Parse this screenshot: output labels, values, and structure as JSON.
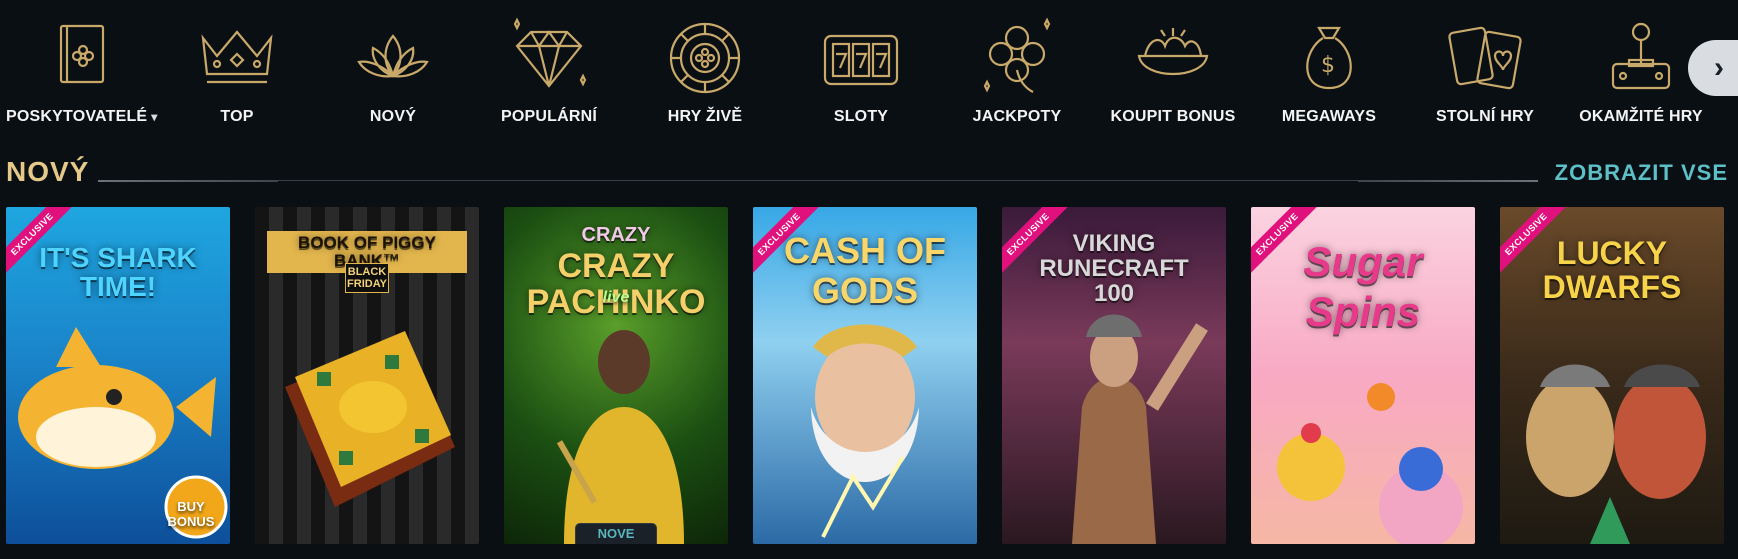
{
  "categories": [
    {
      "label": "POSKYTOVATELÉ",
      "icon": "book-clover-icon",
      "has_dropdown": true
    },
    {
      "label": "TOP",
      "icon": "crown-icon"
    },
    {
      "label": "NOVÝ",
      "icon": "lotus-icon"
    },
    {
      "label": "POPULÁRNÍ",
      "icon": "diamond-icon"
    },
    {
      "label": "HRY ŽIVĚ",
      "icon": "roulette-chip-icon"
    },
    {
      "label": "SLOTY",
      "icon": "slot-777-icon"
    },
    {
      "label": "JACKPOTY",
      "icon": "clover-icon"
    },
    {
      "label": "KOUPIT BONUS",
      "icon": "gold-ingot-icon"
    },
    {
      "label": "MEGAWAYS",
      "icon": "money-bag-icon"
    },
    {
      "label": "STOLNÍ HRY",
      "icon": "playing-cards-icon"
    },
    {
      "label": "OKAMŽITÉ HRY",
      "icon": "joystick-icon"
    }
  ],
  "chevron_glyph": "›",
  "dropdown_glyph": "▾",
  "section": {
    "title": "NOVÝ",
    "view_all": "ZOBRAZIT VSE"
  },
  "games": [
    {
      "title": "IT'S SHARK TIME!",
      "subtitle": "BUY BONUS",
      "ribbon": "EXCLUSIVE",
      "badge": ""
    },
    {
      "title": "BOOK OF PIGGY BANK™",
      "subtitle": "BLACK FRIDAY",
      "ribbon": "",
      "badge": ""
    },
    {
      "title": "CRAZY PACHINKO",
      "subtitle": "live",
      "ribbon": "",
      "badge": "NOVE"
    },
    {
      "title": "CASH OF GODS",
      "subtitle": "",
      "ribbon": "EXCLUSIVE",
      "badge": ""
    },
    {
      "title": "VIKING RUNECRAFT 100",
      "subtitle": "",
      "ribbon": "EXCLUSIVE",
      "badge": ""
    },
    {
      "title": "Sugar Spins",
      "subtitle": "",
      "ribbon": "EXCLUSIVE",
      "badge": ""
    },
    {
      "title": "LUCKY DWARFS",
      "subtitle": "",
      "ribbon": "EXCLUSIVE",
      "badge": ""
    }
  ],
  "colors": {
    "background": "#0a0f14",
    "gold_icon": "#c9a96a",
    "section_title": "#e4c989",
    "link": "#5dbfc7",
    "ribbon": "#e0117d"
  }
}
